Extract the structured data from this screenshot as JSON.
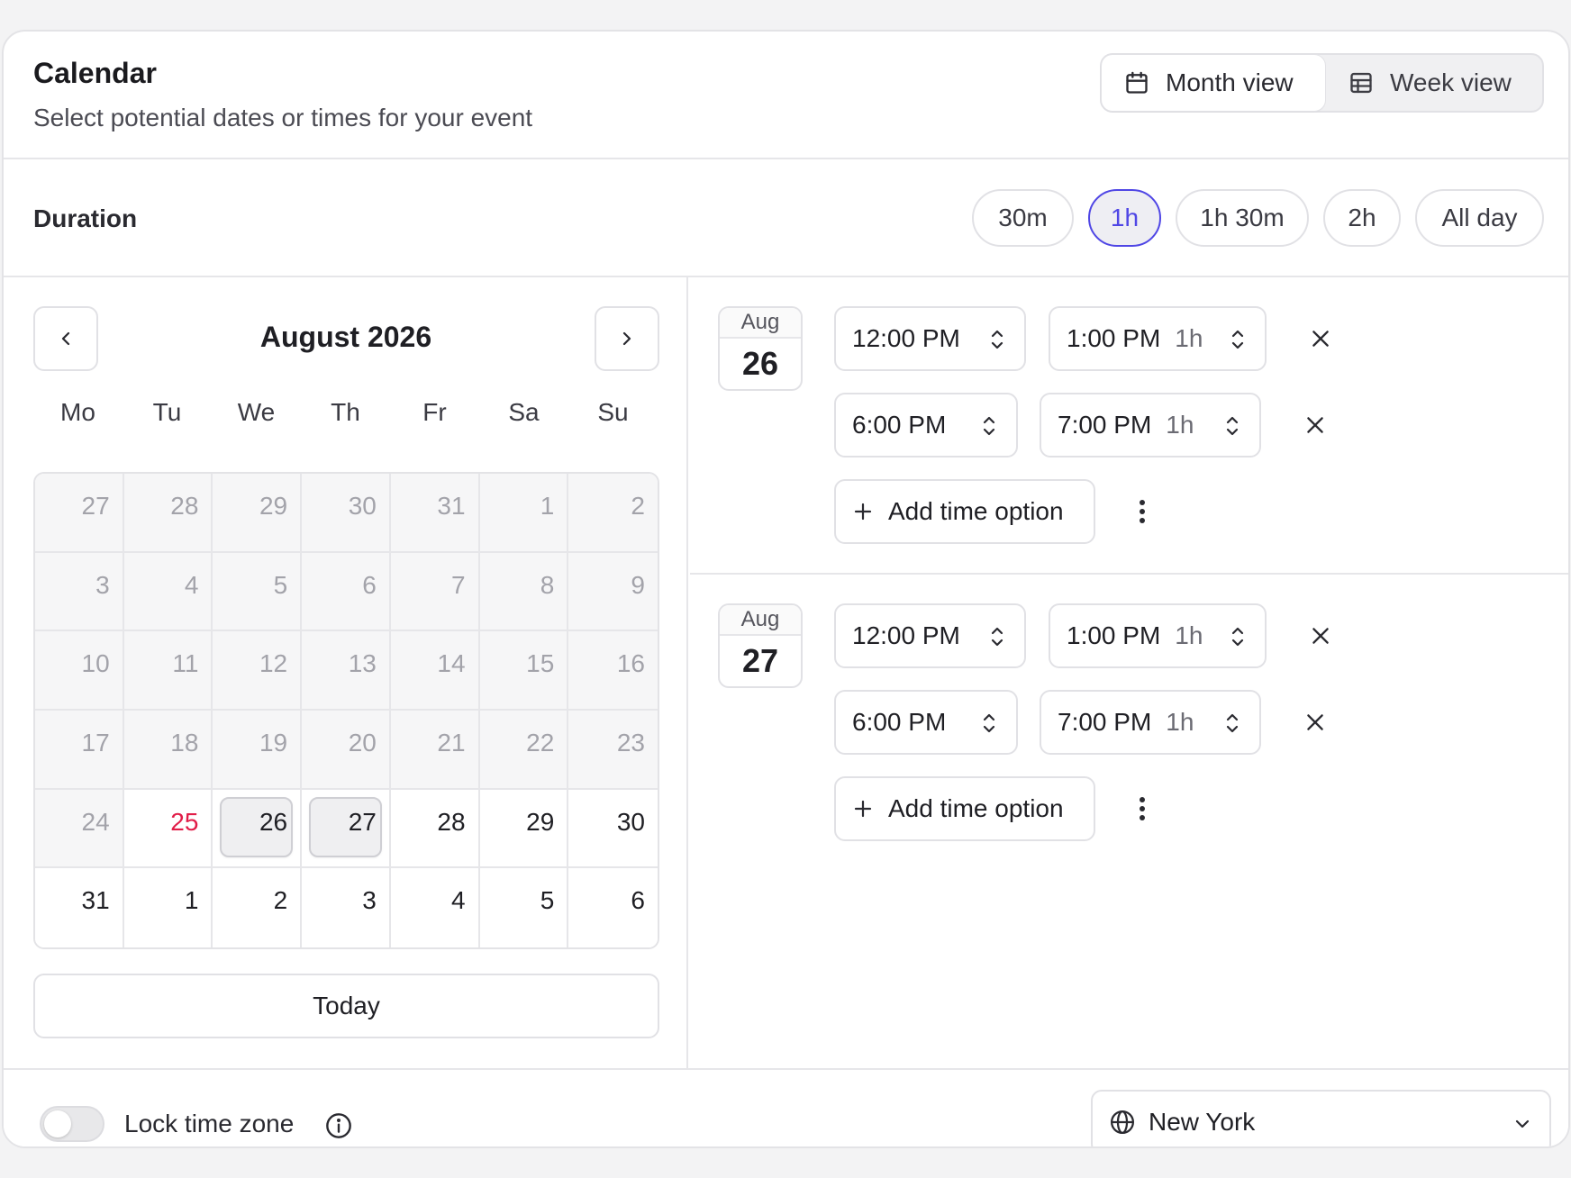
{
  "header": {
    "title": "Calendar",
    "subtitle": "Select potential dates or times for your event",
    "view_toggle": {
      "month_label": "Month view",
      "week_label": "Week view",
      "selected": "Month view"
    }
  },
  "duration": {
    "label": "Duration",
    "options": [
      "30m",
      "1h",
      "1h 30m",
      "2h",
      "All day"
    ],
    "selected": "1h"
  },
  "calendar": {
    "month_title": "August 2026",
    "weekdays": [
      "Mo",
      "Tu",
      "We",
      "Th",
      "Fr",
      "Sa",
      "Su"
    ],
    "weeks": [
      [
        "27",
        "28",
        "29",
        "30",
        "31",
        "1",
        "2"
      ],
      [
        "3",
        "4",
        "5",
        "6",
        "7",
        "8",
        "9"
      ],
      [
        "10",
        "11",
        "12",
        "13",
        "14",
        "15",
        "16"
      ],
      [
        "17",
        "18",
        "19",
        "20",
        "21",
        "22",
        "23"
      ],
      [
        "24",
        "25",
        "26",
        "27",
        "28",
        "29",
        "30"
      ],
      [
        "31",
        "1",
        "2",
        "3",
        "4",
        "5",
        "6"
      ]
    ],
    "today": "25",
    "selected_dates": [
      "26",
      "27"
    ],
    "today_button": "Today",
    "today_color": "#e11d48"
  },
  "days": [
    {
      "month": "Aug",
      "day": "26",
      "slots": [
        {
          "start": "12:00 PM",
          "end": "1:00 PM",
          "duration": "1h"
        },
        {
          "start": "6:00 PM",
          "end": "7:00 PM",
          "duration": "1h"
        }
      ],
      "add_label": "Add time option"
    },
    {
      "month": "Aug",
      "day": "27",
      "slots": [
        {
          "start": "12:00 PM",
          "end": "1:00 PM",
          "duration": "1h"
        },
        {
          "start": "6:00 PM",
          "end": "7:00 PM",
          "duration": "1h"
        }
      ],
      "add_label": "Add time option"
    }
  ],
  "footer": {
    "lock_label": "Lock time zone",
    "lock_enabled": false,
    "timezone": "New York"
  },
  "colors": {
    "accent": "#4f46e5",
    "today": "#e11d48"
  }
}
